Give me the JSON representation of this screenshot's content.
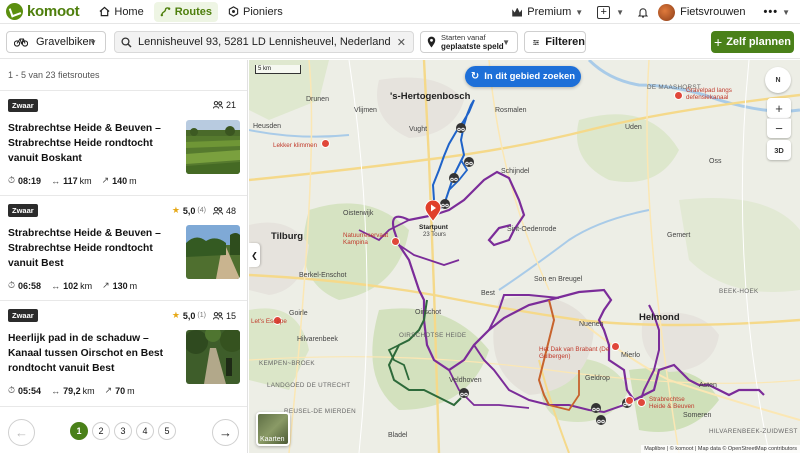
{
  "nav": {
    "logo": "komoot",
    "items": [
      {
        "label": "Home",
        "icon": "home-icon"
      },
      {
        "label": "Routes",
        "icon": "routes-icon"
      },
      {
        "label": "Pioniers",
        "icon": "pioneer-icon"
      }
    ],
    "premium": "Premium",
    "user": "Fietsvrouwen",
    "more": "•••"
  },
  "filters": {
    "sport": "Gravelbiken",
    "search_value": "Lennisheuvel 93, 5281 LD Lennisheuvel, Nederland, Lennishe…",
    "start_small": "Starten vanaf",
    "start_big": "geplaatste speld",
    "filter_label": "Filteren",
    "plan_label": "Zelf plannen"
  },
  "sidebar": {
    "count": "1 - 5 van 23 fietsroutes",
    "cards": [
      {
        "badge": "Zwaar",
        "rating": "",
        "rating_count": "",
        "people": "21",
        "title": "Strabrechtse Heide & Beuven – Strabrechtse Heide rondtocht vanuit Boskant",
        "time": "08:19",
        "distance": "117",
        "distance_unit": "km",
        "elevation": "140",
        "elevation_unit": "m"
      },
      {
        "badge": "Zwaar",
        "rating": "5,0",
        "rating_count": "(4)",
        "people": "48",
        "title": "Strabrechtse Heide & Beuven – Strabrechtse Heide rondtocht vanuit Best",
        "time": "06:58",
        "distance": "102",
        "distance_unit": "km",
        "elevation": "130",
        "elevation_unit": "m"
      },
      {
        "badge": "Zwaar",
        "rating": "5,0",
        "rating_count": "(1)",
        "people": "15",
        "title": "Heerlijk pad in de schaduw – Kanaal tussen Oirschot en Best rondtocht vanuit Best",
        "time": "05:54",
        "distance": "79,2",
        "distance_unit": "km",
        "elevation": "70",
        "elevation_unit": "m"
      }
    ],
    "pages": [
      "1",
      "2",
      "3",
      "4",
      "5"
    ],
    "active_page": "1"
  },
  "map": {
    "search_area": "In dit gebied zoeken",
    "scale": "5 km",
    "compass": "N",
    "zoom_in": "+",
    "zoom_out": "−",
    "three_d": "3D",
    "layers": "Kaarten",
    "attribution": "Maplibre | © komoot | Map data © OpenStreetMap contributors",
    "startpoint": "Startpunt",
    "startpoint_sub": "23 Tours",
    "labels": {
      "den_bosch": "'s-Hertogenbosch",
      "tilburg": "Tilburg",
      "helmond": "Helmond",
      "vught": "Vught",
      "drunen": "Drunen",
      "vlijmen": "Vlijmen",
      "heusden": "Heusden",
      "rosmalen": "Rosmalen",
      "schijndel": "Schijndel",
      "sint_oedenrode": "Sint-Oedenrode",
      "son": "Son en Breugel",
      "best": "Best",
      "oirschot": "Oirschot",
      "oisterwijk": "Oisterwijk",
      "berkel": "Berkel-Enschot",
      "goirle": "Goirle",
      "hilvarenbeek": "Hilvarenbeek",
      "nuenen": "Nuenen",
      "mierlo": "Mierlo",
      "geldrop": "Geldrop",
      "veldhoven": "Veldhoven",
      "bladel": "Bladel",
      "someren": "Someren",
      "asten": "Asten",
      "gemert": "Gemert",
      "uden": "Uden",
      "oss": "Oss",
      "boxmeer_area": "DE MAASHORST",
      "kempen": "KEMPEN~BROEK",
      "oirschotse_heide": "OIRSCHOTSE HEIDE",
      "landgoed": "LANDGOED DE UTRECHT",
      "reusel": "REUSEL-DE MIERDEN",
      "cuijk": "BEEK-HOEK",
      "zuidoost": "HILVARENBEEK-ZUIDWEST",
      "poi_lekker_klimmen": "Lekker klimmen",
      "poi_kampina": "Natuurreservaat Kampina",
      "poi_gravelpad": "Gravelpad langs defensiekanaal",
      "poi_dak_brabant": "Het Dak van Brabant (De Gulbergen)",
      "poi_strabrechtse": "Strabrechtse Heide & Beuven",
      "poi_lets": "Let's Escape"
    }
  }
}
